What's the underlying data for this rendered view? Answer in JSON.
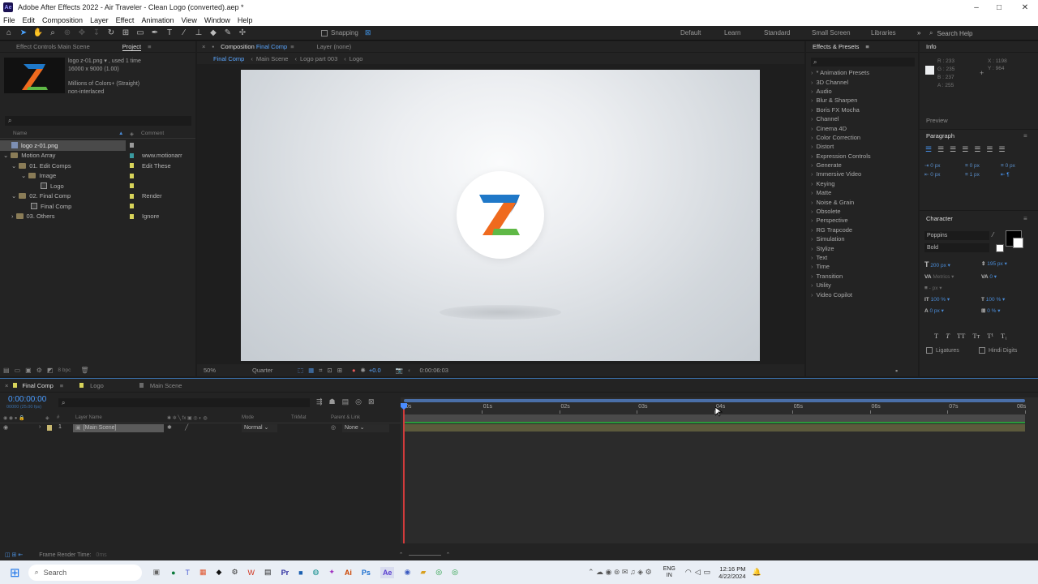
{
  "window": {
    "app_icon": "Ae",
    "title": "Adobe After Effects 2022 - Air Traveler - Clean Logo (converted).aep *",
    "minimize": "–",
    "maximize": "□",
    "close": "✕"
  },
  "menu": [
    "File",
    "Edit",
    "Composition",
    "Layer",
    "Effect",
    "Animation",
    "View",
    "Window",
    "Help"
  ],
  "toolbar": {
    "snapping": "Snapping",
    "workspaces": [
      "Default",
      "Learn",
      "Standard",
      "Small Screen",
      "Libraries"
    ],
    "search_help": "Search Help"
  },
  "project_panel": {
    "tabs": {
      "effect_controls": "Effect Controls Main Scene",
      "project": "Project"
    },
    "file_name": "logo z-01.png ▾ , used 1 time",
    "file_dims": "16000 x 9000 (1.00)",
    "file_colors": "Millions of Colors+ (Straight)",
    "file_interlace": "non-interlaced",
    "headers": {
      "name": "Name",
      "comment": "Comment"
    },
    "items": [
      {
        "name": "logo z-01.png",
        "comment": "",
        "type": "img",
        "indent": 0,
        "selected": true,
        "color": "#9a9a9a"
      },
      {
        "name": "Motion Array",
        "comment": "www.motionarr",
        "type": "folder",
        "indent": 0,
        "color": "#3a9aa0"
      },
      {
        "name": "01. Edit Comps",
        "comment": "Edit These",
        "type": "folder",
        "indent": 1,
        "color": "#d8d45a"
      },
      {
        "name": "Image",
        "comment": "",
        "type": "folder",
        "indent": 2,
        "color": "#d8d45a"
      },
      {
        "name": "Logo",
        "comment": "",
        "type": "comp",
        "indent": 3,
        "color": "#d8d45a"
      },
      {
        "name": "02. Final Comp",
        "comment": "Render",
        "type": "folder",
        "indent": 1,
        "color": "#d8d45a"
      },
      {
        "name": "Final Comp",
        "comment": "",
        "type": "comp",
        "indent": 2,
        "color": "#d8d45a"
      },
      {
        "name": "03. Others",
        "comment": "Ignore",
        "type": "folder",
        "indent": 1,
        "color": "#d8d45a"
      }
    ],
    "bpc": "8 bpc"
  },
  "composition": {
    "tab": "Composition",
    "tab_name": "Final Comp",
    "layer_tab": "Layer (none)",
    "breadcrumbs": [
      "Final Comp",
      "Main Scene",
      "Logo part 003",
      "Logo"
    ],
    "zoom": "50%",
    "resolution": "Quarter",
    "exposure": "+0.0",
    "timecode": "0:00:06:03"
  },
  "effects_panel": {
    "title": "Effects & Presets",
    "items": [
      "* Animation Presets",
      "3D Channel",
      "Audio",
      "Blur & Sharpen",
      "Boris FX Mocha",
      "Channel",
      "Cinema 4D",
      "Color Correction",
      "Distort",
      "Expression Controls",
      "Generate",
      "Immersive Video",
      "Keying",
      "Matte",
      "Noise & Grain",
      "Obsolete",
      "Perspective",
      "RG Trapcode",
      "Simulation",
      "Stylize",
      "Text",
      "Time",
      "Transition",
      "Utility",
      "Video Copilot"
    ]
  },
  "info_panel": {
    "title": "Info",
    "r": "R : 233",
    "g": "G : 235",
    "b": "B : 237",
    "a": "A : 255",
    "x": "X : 1198",
    "y": "Y : 964",
    "preview": "Preview",
    "paragraph": "Paragraph",
    "para_vals": [
      "0 px",
      "0 px",
      "0 px",
      "0 px",
      "0 px",
      "1 px"
    ]
  },
  "character_panel": {
    "title": "Character",
    "font": "Poppins",
    "style": "Bold",
    "size": "200 px",
    "leading": "195 px",
    "kerning": "Metrics",
    "tracking": "0",
    "stroke": "- px",
    "vscale": "100 %",
    "hscale": "100 %",
    "baseline": "0 px",
    "tsume": "0 %",
    "ligatures": "Ligatures",
    "hindi": "Hindi Digits",
    "fill_color": "#000000",
    "stroke_color": "#ffffff"
  },
  "timeline": {
    "tabs": [
      "Final Comp",
      "Logo",
      "Main Scene"
    ],
    "timecode": "0:00:00:00",
    "fps": "00000 (25.00 fps)",
    "headers": {
      "layer_name": "Layer Name",
      "mode": "Mode",
      "trkmat": "TrkMat",
      "parent": "Parent & Link"
    },
    "layer": {
      "index": "1",
      "name": "[Main Scene]",
      "mode": "Normal",
      "parent": "None"
    },
    "ruler": [
      "0s",
      "01s",
      "02s",
      "03s",
      "04s",
      "05s",
      "06s",
      "07s",
      "08s"
    ],
    "status": "Frame Render Time:",
    "render_time": "0ms",
    "duration_seconds": 8,
    "playhead_seconds": 0,
    "work_area_color": "#2a9a3a"
  },
  "taskbar": {
    "search": "Search",
    "lang": "ENG",
    "lang2": "IN",
    "time": "12:16 PM",
    "date": "4/22/2024",
    "apps": [
      "Ai",
      "Ps",
      "Ae",
      "Pr"
    ]
  },
  "colors": {
    "accent": "#2b8cff",
    "label_yellow": "#d8d45a",
    "teal": "#3a9aa0",
    "logo_orange": "#ef6a1e",
    "logo_blue": "#1f78c8",
    "logo_green": "#5fb846"
  }
}
